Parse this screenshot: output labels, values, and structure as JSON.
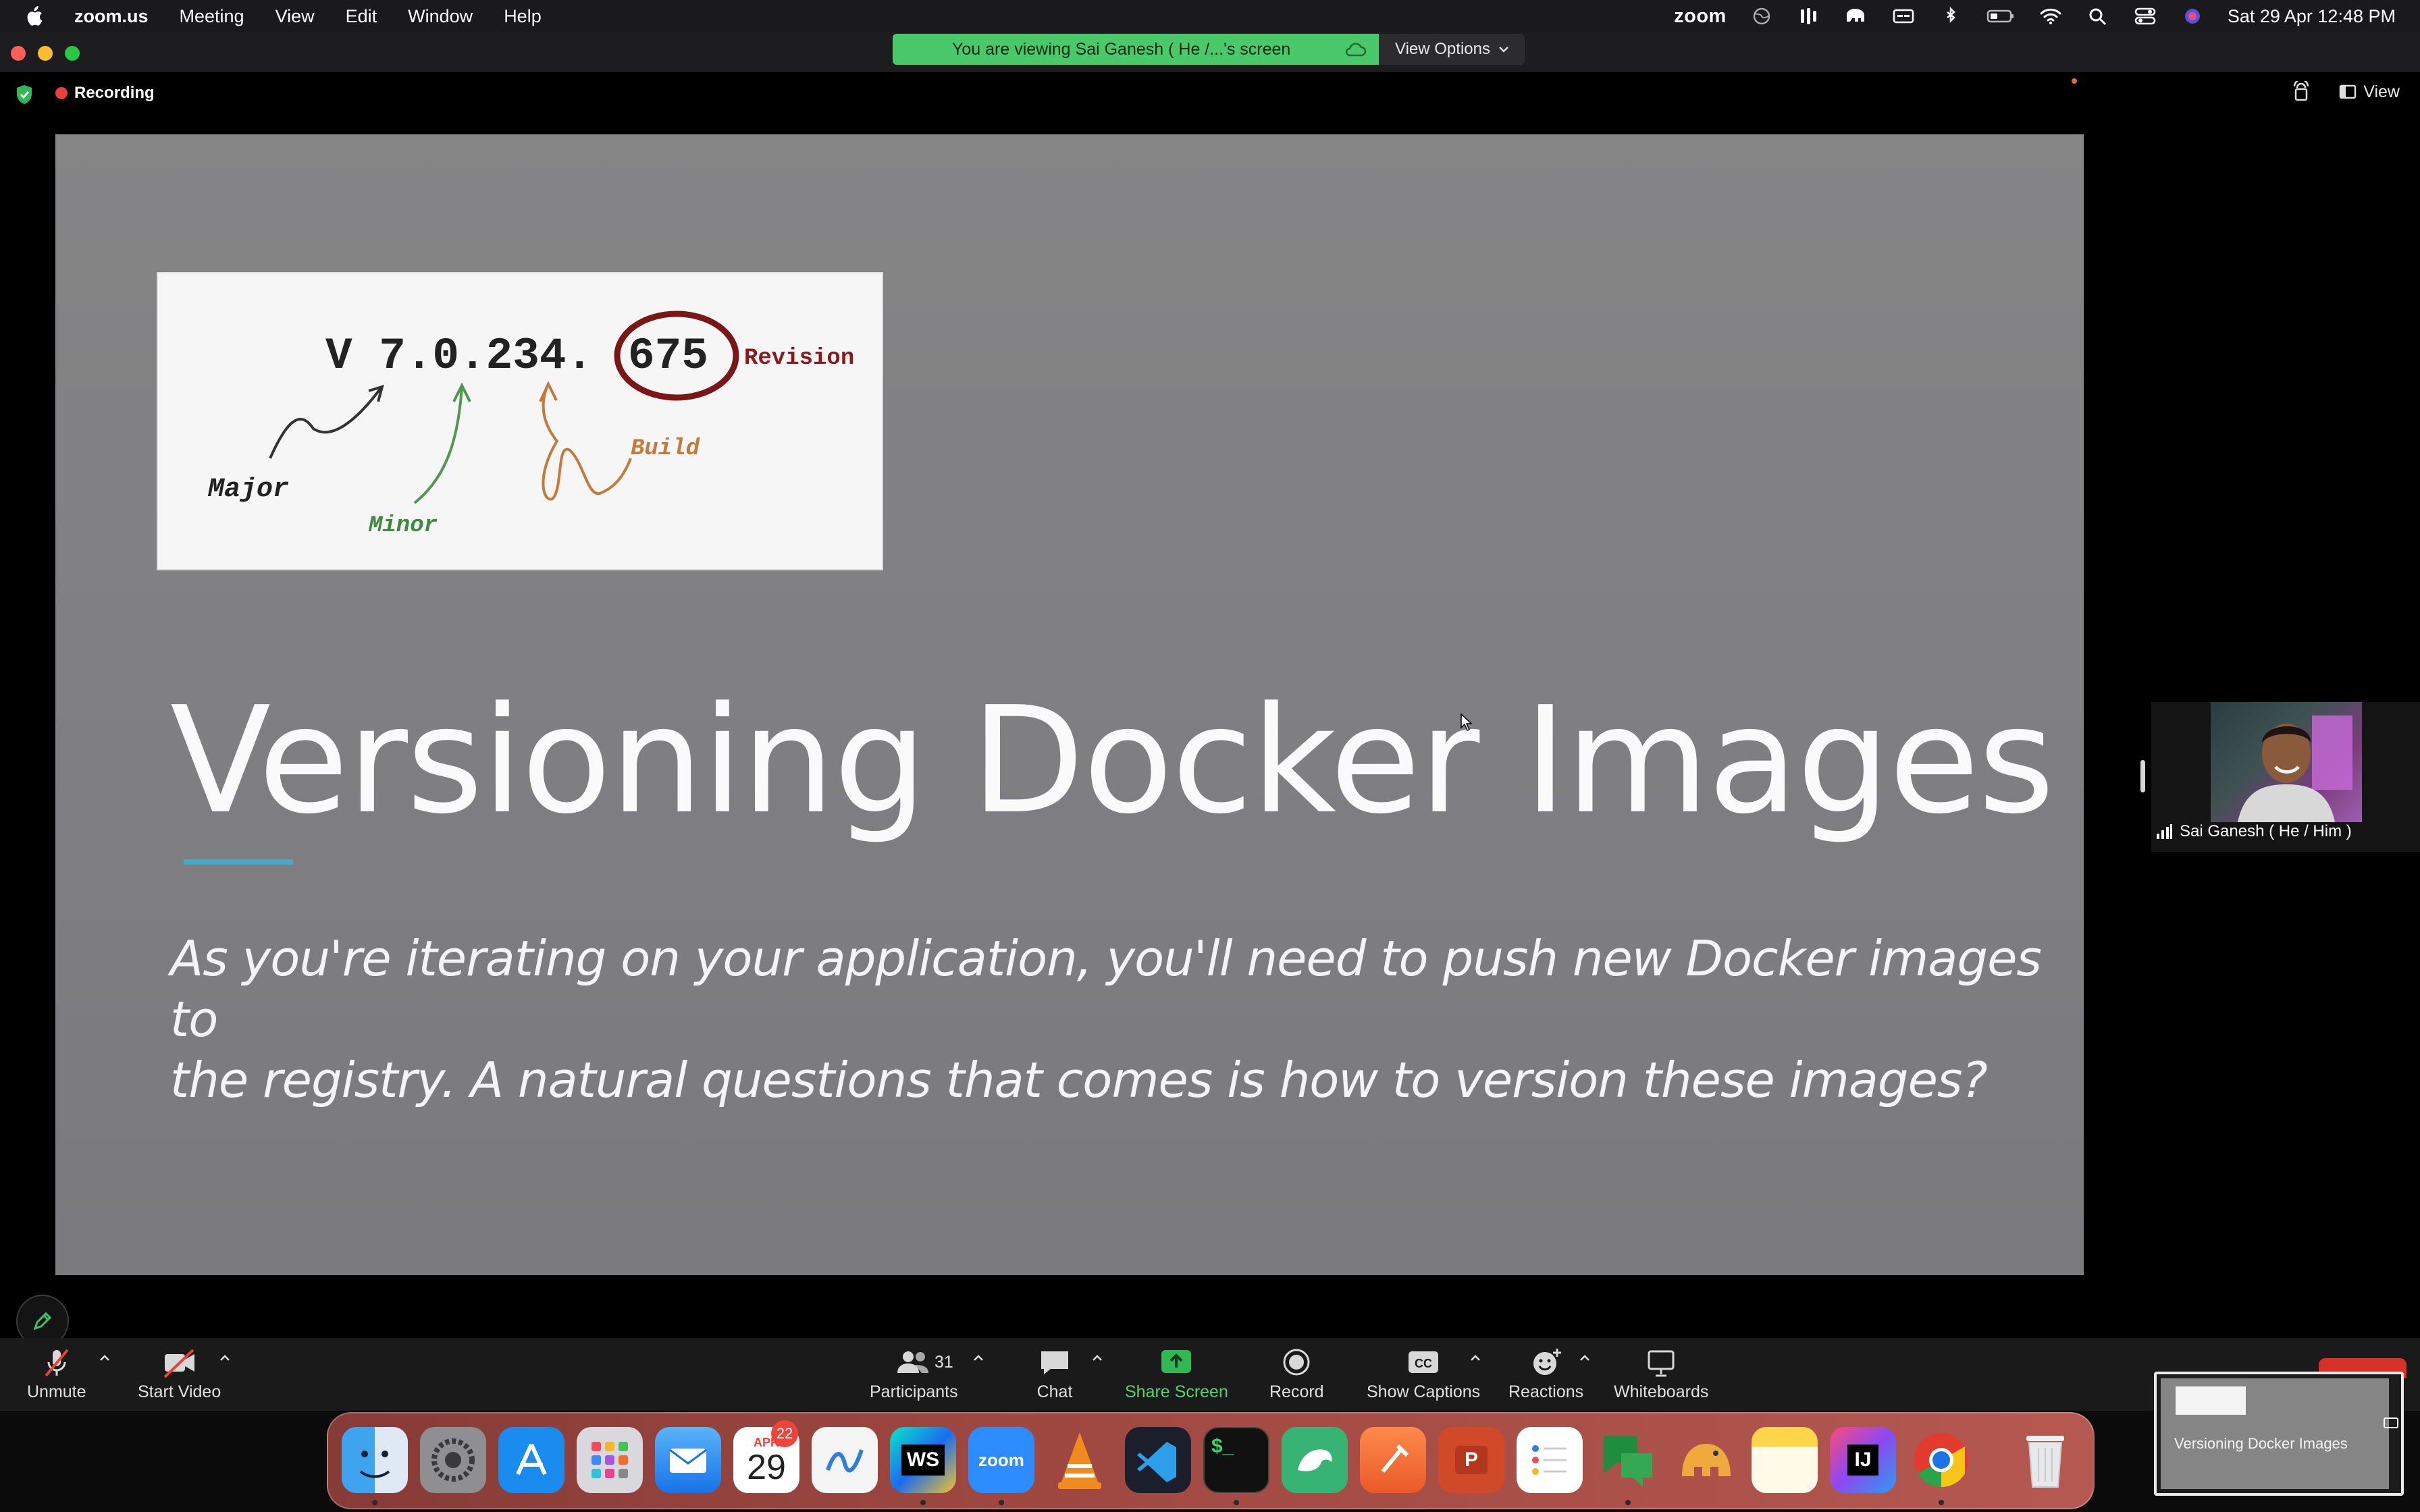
{
  "menubar": {
    "app_name": "zoom.us",
    "menus": [
      "Meeting",
      "View",
      "Edit",
      "Window",
      "Help"
    ],
    "zoom_status_label": "zoom",
    "datetime": "Sat 29 Apr  12:48 PM"
  },
  "banner": {
    "viewing_text": "You are viewing Sai Ganesh ( He /...'s screen",
    "view_options_label": "View Options"
  },
  "meeting": {
    "recording_label": "Recording",
    "view_label": "View"
  },
  "slide": {
    "image": {
      "version_text": "V 7.0.234.",
      "revision_number": "675",
      "revision_label": "Revision",
      "major_label": "Major",
      "minor_label": "Minor",
      "build_label": "Build"
    },
    "title": "Versioning Docker Images",
    "body_line1": "As you're iterating on your application, you'll need to push new Docker images to",
    "body_line2": "the registry. A natural questions that comes is how to version these images?"
  },
  "participant": {
    "name": "Sai Ganesh ( He / Him )"
  },
  "toolbar": {
    "unmute_label": "Unmute",
    "start_video_label": "Start Video",
    "participants_label": "Participants",
    "participants_count": "31",
    "chat_label": "Chat",
    "share_screen_label": "Share Screen",
    "record_label": "Record",
    "captions_label": "Show Captions",
    "captions_icon_text": "CC",
    "reactions_label": "Reactions",
    "whiteboards_label": "Whiteboards"
  },
  "dock": {
    "calendar_month": "APR",
    "calendar_day": "29",
    "calendar_badge": "22",
    "zoom_icon_text": "zoom",
    "webstorm_text": "WS",
    "intellij_text": "IJ",
    "terminal_text": "$_",
    "powerpoint_text": "P"
  },
  "mini_preview": {
    "title": "Versioning Docker Images"
  },
  "colors": {
    "share_green": "#4ac96b",
    "recording_red": "#e8413a",
    "slide_gray": "#828284",
    "underline_teal": "#4aa7c4",
    "revision_circle": "#8b1a1a",
    "build_orange": "#c47a3a",
    "minor_green": "#3f8a3f"
  }
}
